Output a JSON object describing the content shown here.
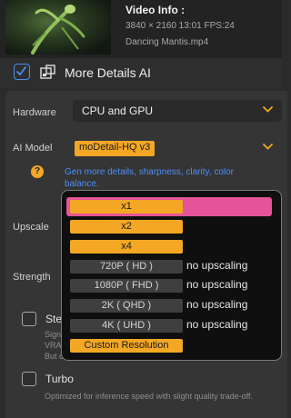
{
  "video_info": {
    "title": "Video Info :",
    "meta": "3840 × 2160 13:01 FPS:24",
    "filename": "Dancing Mantis.mp4"
  },
  "more_details": {
    "checked": true,
    "label": "More Details AI"
  },
  "hardware": {
    "label": "Hardware",
    "value": "CPU and GPU"
  },
  "ai_model": {
    "label": "AI Model",
    "value": "moDetail-HQ  v3",
    "help_glyph": "?",
    "description": "Gen more details, sharpness, clarity, color balance."
  },
  "upscale": {
    "label": "Upscale"
  },
  "strength": {
    "label": "Strength"
  },
  "dropdown": {
    "options": [
      {
        "label": "x1",
        "note": "",
        "selected": true
      },
      {
        "label": "x2",
        "note": ""
      },
      {
        "label": "x4",
        "note": ""
      },
      {
        "label": "720P ( HD )",
        "note": "no upscaling"
      },
      {
        "label": "1080P ( FHD )",
        "note": "no upscaling"
      },
      {
        "label": "2K  ( QHD )",
        "note": "no upscaling"
      },
      {
        "label": "4K  ( UHD )",
        "note": "no upscaling"
      },
      {
        "label": "Custom Resolution",
        "note": ""
      }
    ]
  },
  "stable_item": {
    "title": "Ste",
    "lines": [
      "Sign",
      "VRA",
      "But c"
    ]
  },
  "turbo": {
    "title": "Turbo",
    "desc": "Optimized for inference speed with slight quality trade-off."
  },
  "colors": {
    "accent_orange": "#f3a724",
    "accent_blue": "#4d8ff7",
    "highlight_pink": "#e55498"
  }
}
